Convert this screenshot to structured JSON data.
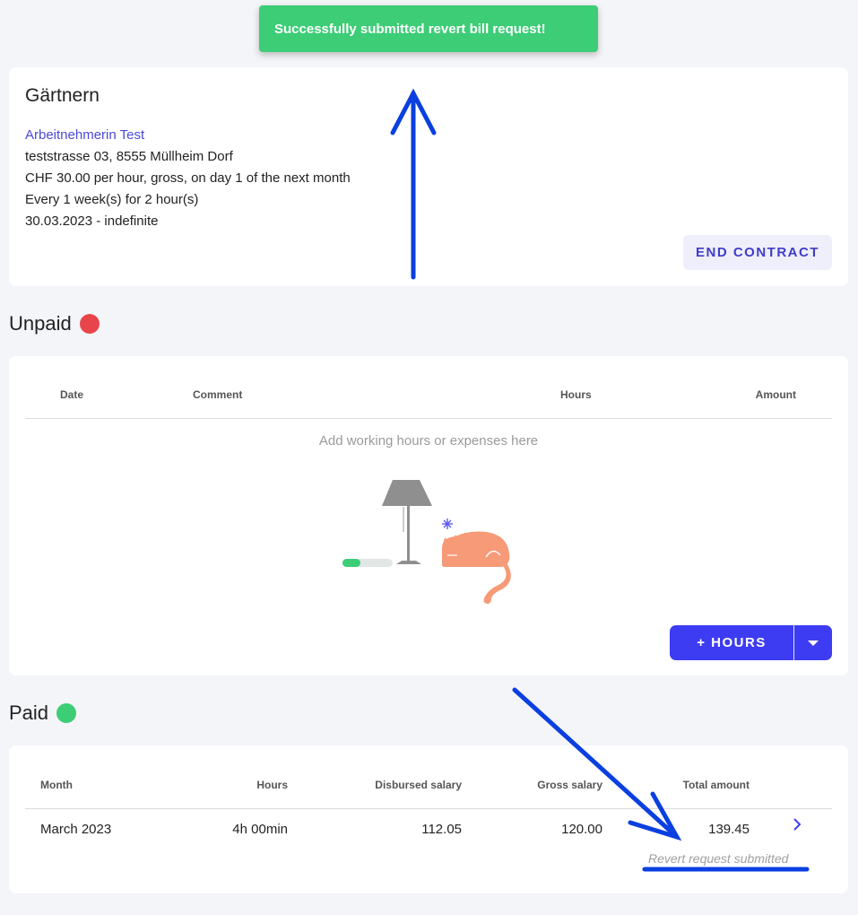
{
  "toast": {
    "message": "Successfully submitted revert bill request!"
  },
  "contract": {
    "title": "Gärtnern",
    "employee": "Arbeitnehmerin Test",
    "address": "teststrasse 03, 8555 Müllheim Dorf",
    "rate": "CHF 30.00 per hour, gross, on day 1 of the next month",
    "schedule": "Every 1 week(s) for 2 hour(s)",
    "period": "30.03.2023 - indefinite",
    "end_label": "END CONTRACT"
  },
  "unpaid": {
    "title": "Unpaid",
    "status_color": "#e8454b",
    "columns": [
      "Date",
      "Comment",
      "Hours",
      "Amount"
    ],
    "empty_text": "Add working hours or expenses here",
    "add_label": "+ HOURS"
  },
  "paid": {
    "title": "Paid",
    "status_color": "#3ccd76",
    "columns": [
      "Month",
      "Hours",
      "Disbursed salary",
      "Gross salary",
      "Total amount"
    ],
    "rows": [
      {
        "month": "March 2023",
        "hours": "4h 00min",
        "disbursed": "112.05",
        "gross": "120.00",
        "total": "139.45",
        "note": "Revert request submitted"
      }
    ]
  },
  "colors": {
    "accent": "#3d3cf3",
    "success": "#3ccd76",
    "danger": "#e8454b",
    "annotation": "#0a3fe0"
  },
  "icons": [
    "chevron-right-icon",
    "caret-down-icon",
    "lamp-cat-illustration"
  ]
}
